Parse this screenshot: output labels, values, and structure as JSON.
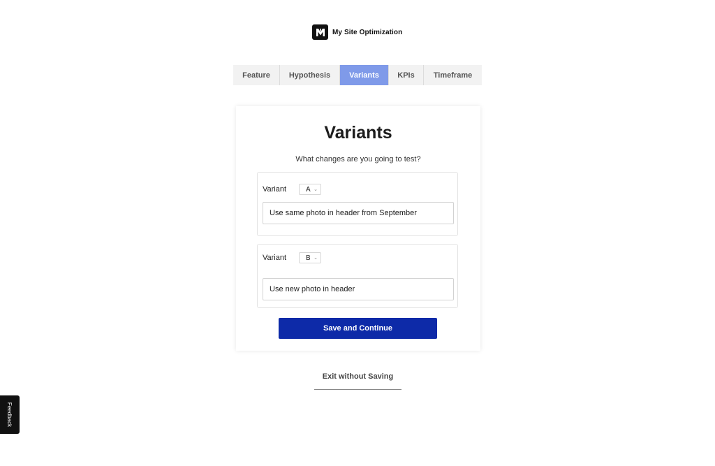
{
  "brand": {
    "name": "My Site Optimization",
    "logo_icon": "brand-logo-icon"
  },
  "tabs": [
    {
      "label": "Feature",
      "active": false
    },
    {
      "label": "Hypothesis",
      "active": false
    },
    {
      "label": "Variants",
      "active": true
    },
    {
      "label": "KPIs",
      "active": false
    },
    {
      "label": "Timeframe",
      "active": false
    }
  ],
  "card": {
    "title": "Variants",
    "subtitle": "What changes are you going to test?",
    "variants": [
      {
        "label": "Variant",
        "selected": "A",
        "value": "Use same photo in header from September"
      },
      {
        "label": "Variant",
        "selected": "B",
        "value": "Use new photo in header"
      }
    ],
    "save_label": "Save and Continue"
  },
  "exit_label": "Exit without Saving",
  "feedback_label": "Feedback",
  "colors": {
    "active_tab": "#7f9ae9",
    "primary_button": "#0d2aa8",
    "tab_bar": "#f2f2f2"
  }
}
